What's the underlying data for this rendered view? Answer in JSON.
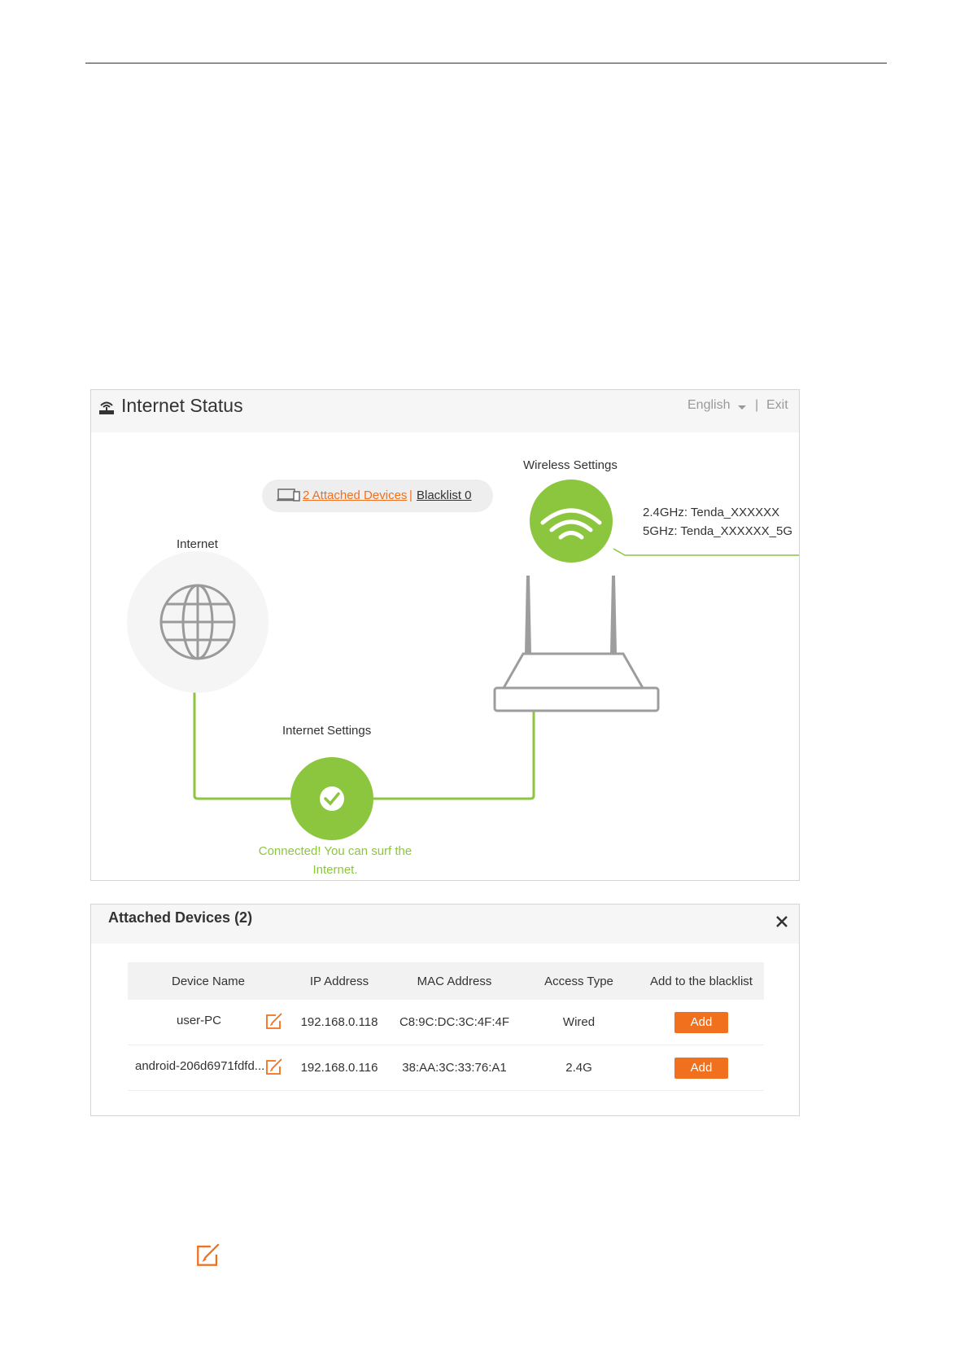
{
  "status_panel": {
    "title": "Internet Status",
    "language": "English",
    "separator": "|",
    "exit_label": "Exit",
    "attached_link": "2 Attached Devices ",
    "pill_separator": "|",
    "blacklist_link": "Blacklist 0",
    "internet_label": "Internet",
    "wireless_label": "Wireless Settings",
    "ssid_24": "2.4GHz: Tenda_XXXXXX",
    "ssid_5": "5GHz: Tenda_XXXXXX_5G",
    "internet_settings_label": "Internet Settings",
    "connected_msg": "Connected! You can surf the Internet."
  },
  "devices_panel": {
    "title": "Attached Devices (2)",
    "columns": [
      "Device Name",
      "IP Address",
      "MAC Address",
      "Access Type",
      "Add to the blacklist"
    ],
    "rows": [
      {
        "name": "user-PC",
        "ip": "192.168.0.118",
        "mac": "C8:9C:DC:3C:4F:4F",
        "type": "Wired",
        "action": "Add"
      },
      {
        "name": "android-206d6971fdfd...",
        "ip": "192.168.0.116",
        "mac": "38:AA:3C:33:76:A1",
        "type": "2.4G",
        "action": "Add"
      }
    ]
  },
  "colors": {
    "accent_green": "#8cc63e",
    "accent_orange": "#f0701e"
  }
}
